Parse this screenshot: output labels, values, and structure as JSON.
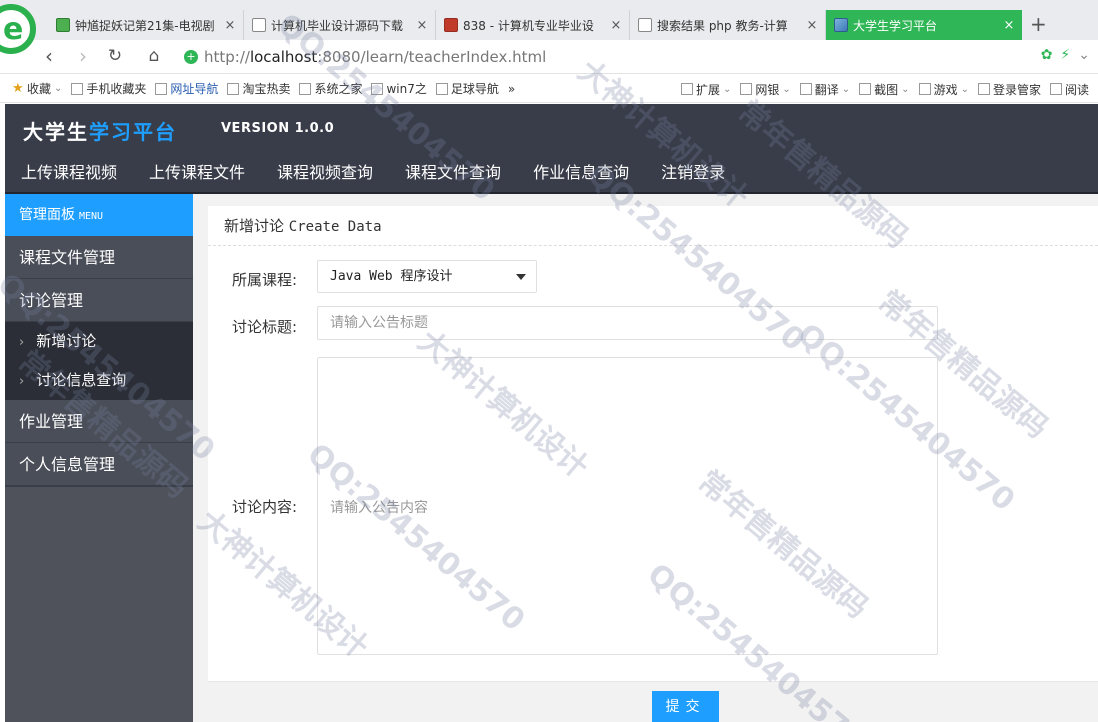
{
  "browser": {
    "logo_letter": "e",
    "tabs": [
      {
        "label": "钟馗捉妖记第21集-电视剧",
        "close": "×"
      },
      {
        "label": "计算机毕业设计源码下载",
        "close": "×"
      },
      {
        "label": "838 - 计算机专业毕业设",
        "close": "×"
      },
      {
        "label": "搜索结果 php 教务-计算",
        "close": "×"
      },
      {
        "label": "大学生学习平台",
        "close": "×"
      }
    ],
    "new_tab": "+",
    "url_prefix": "http://",
    "url_host": "localhost",
    "url_rest": ":8080/learn/teacherIndex.html",
    "bookmarks": [
      "收藏",
      "手机收藏夹",
      "网址导航",
      "淘宝热卖",
      "系统之家",
      "win7之",
      "足球导航",
      "»"
    ],
    "bookmarks_right": [
      "扩展",
      "网银",
      "翻译",
      "截图",
      "游戏",
      "登录管家",
      "阅读"
    ]
  },
  "header": {
    "logo_white": "大学生",
    "logo_blue": "学习平台",
    "version": "VERSION 1.0.0",
    "nav": [
      "上传课程视频",
      "上传课程文件",
      "课程视频查询",
      "课程文件查询",
      "作业信息查询",
      "注销登录"
    ]
  },
  "sidebar": {
    "head": "管理面板",
    "head_en": "MENU",
    "items": [
      "课程文件管理",
      "讨论管理"
    ],
    "sub_items": [
      "新增讨论",
      "讨论信息查询"
    ],
    "items_after": [
      "作业管理",
      "个人信息管理"
    ]
  },
  "form": {
    "title": "新增讨论",
    "title_en": "Create Data",
    "course_label": "所属课程:",
    "course_value": "Java Web 程序设计",
    "subject_label": "讨论标题:",
    "subject_placeholder": "请输入公告标题",
    "content_label": "讨论内容:",
    "content_placeholder": "请输入公告内容",
    "submit": "提交"
  },
  "watermark": {
    "qq": "QQ:2545404570",
    "a": "大神计算机设计",
    "b": "常年售精品源码"
  }
}
